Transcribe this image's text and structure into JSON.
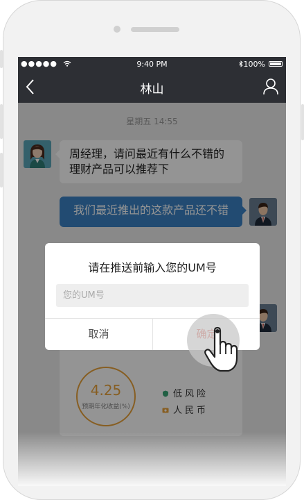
{
  "status_bar": {
    "signal": "●●●●●",
    "time": "9:40 PM",
    "battery": "100%"
  },
  "nav": {
    "title": "林山"
  },
  "chat": {
    "timestamp": "星期五 14:55",
    "messages": [
      {
        "from": "client",
        "text": "周经理，请问最近有什么不错的理财产品可以推荐下"
      },
      {
        "from": "manager",
        "text": "我们最近推出的这款产品还不错"
      }
    ],
    "product_card": {
      "rate_value": "4.25",
      "rate_label": "预期年化收益(%)",
      "tags": [
        "低风险",
        "人民币"
      ]
    }
  },
  "dialog": {
    "title": "请在推送前输入您的UM号",
    "input_placeholder": "您的UM号",
    "cancel_label": "取消",
    "confirm_label": "确定"
  },
  "colors": {
    "nav_bg": "#2d2f34",
    "outgoing_bubble": "#3b82c4",
    "confirm_text": "#e05a4e",
    "rate_accent": "#e8a33c"
  },
  "icons": [
    "back-icon",
    "user-icon",
    "wifi-icon",
    "bluetooth-icon",
    "battery-icon",
    "shield-icon",
    "currency-icon",
    "pointer-hand-icon"
  ]
}
